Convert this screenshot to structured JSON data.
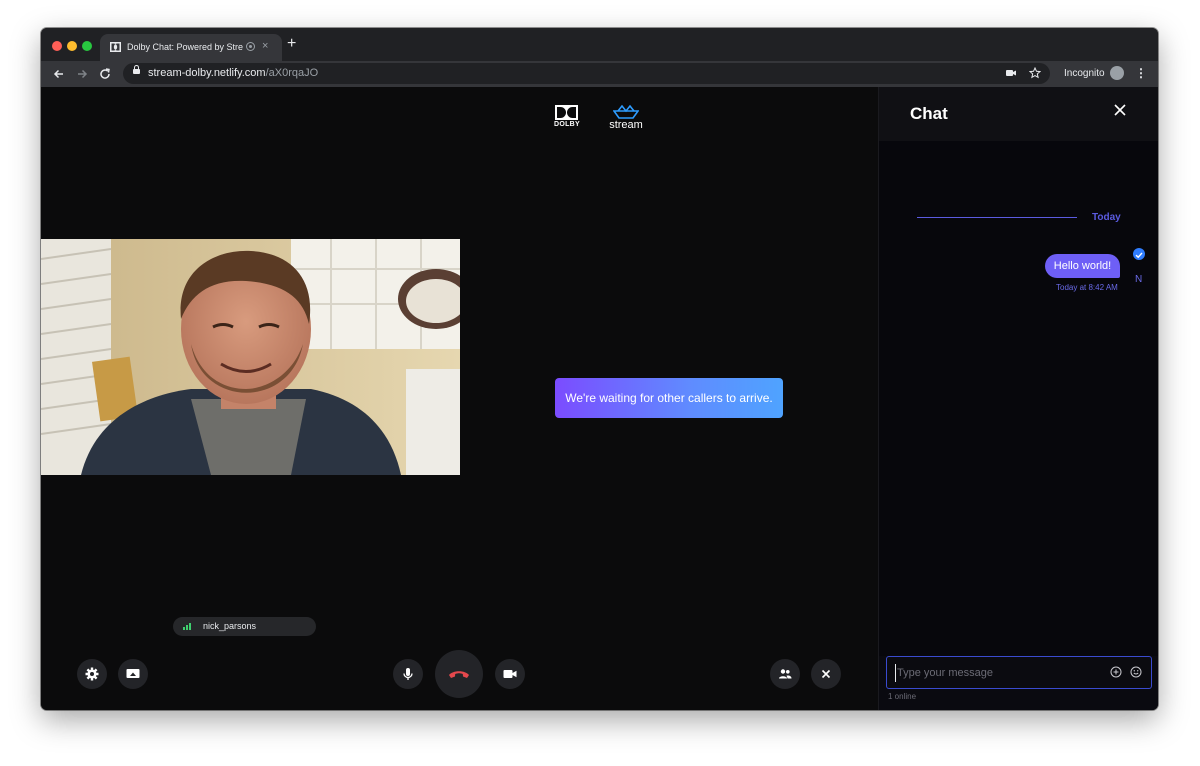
{
  "browser": {
    "tab_title": "Dolby Chat: Powered by Stre",
    "tab_close": "×",
    "new_tab": "+",
    "url_host": "stream-dolby.netlify.com",
    "url_path": "/aX0rqaJO",
    "incognito_label": "Incognito",
    "menu": "⋮"
  },
  "branding": {
    "dolby_label": "DOLBY",
    "stream_label": "stream"
  },
  "call": {
    "waiting_message": "We're waiting for other callers to arrive.",
    "participant_name": "nick_parsons"
  },
  "chat": {
    "title": "Chat",
    "date_separator": "Today",
    "messages": [
      {
        "text": "Hello world!",
        "time": "Today at 8:42 AM",
        "avatar_initial": "N"
      }
    ],
    "input_placeholder": "Type your message",
    "online_status": "1 online"
  },
  "colors": {
    "accent": "#6e5ff6",
    "hangup_red": "#e5484d",
    "background": "#0b0b0c"
  }
}
